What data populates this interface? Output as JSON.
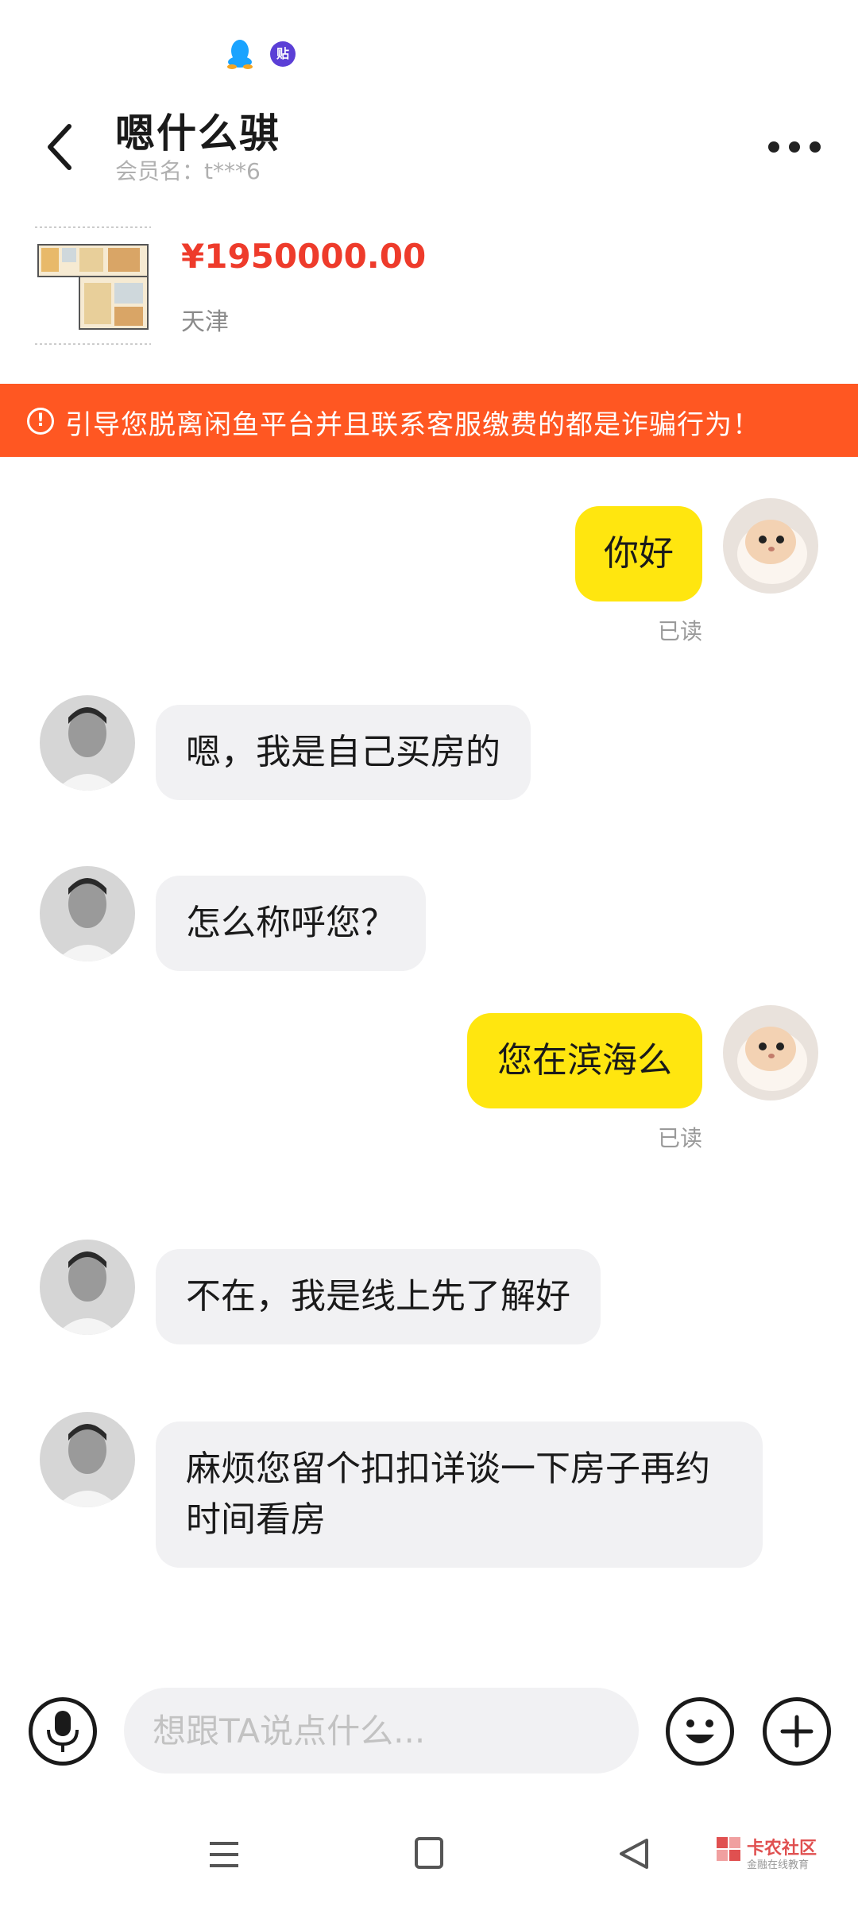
{
  "status_bar": {
    "tieba_badge": "贴"
  },
  "header": {
    "title": "嗯什么骐",
    "member_name": "会员名：t***6"
  },
  "product": {
    "price": "¥1950000.00",
    "location": "天津"
  },
  "warning": {
    "icon": "!",
    "text": "引导您脱离闲鱼平台并且联系客服缴费的都是诈骗行为！"
  },
  "messages": [
    {
      "sender": "me",
      "text": "你好",
      "status": "已读"
    },
    {
      "sender": "them",
      "text": "嗯，我是自己买房的"
    },
    {
      "sender": "them",
      "text": "怎么称呼您？"
    },
    {
      "sender": "me",
      "text": "您在滨海么",
      "status": "已读"
    },
    {
      "sender": "them",
      "text": "不在，我是线上先了解好"
    },
    {
      "sender": "them",
      "text": "麻烦您留个扣扣详谈一下房子再约时间看房"
    }
  ],
  "input": {
    "placeholder": "想跟TA说点什么..."
  },
  "watermark": {
    "title": "卡农社区",
    "subtitle": "金融在线教育"
  },
  "colors": {
    "warning_bg": "#ff5722",
    "my_bubble": "#ffe60f",
    "their_bubble": "#f1f1f3",
    "price": "#ee3b2b"
  }
}
